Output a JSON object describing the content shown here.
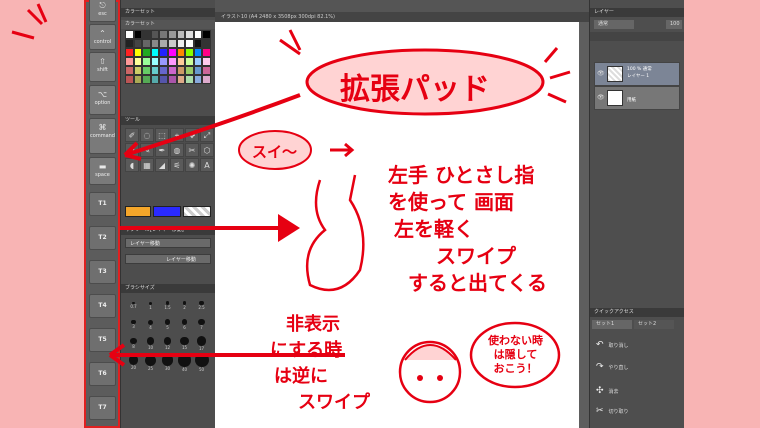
{
  "edge_pad": {
    "keys": [
      {
        "label": "esc",
        "icon": "escape-icon",
        "glyph": "⎋"
      },
      {
        "label": "control",
        "icon": "control-icon",
        "glyph": "⌃"
      },
      {
        "label": "shift",
        "icon": "shift-icon",
        "glyph": "⇧"
      },
      {
        "label": "option",
        "icon": "option-icon",
        "glyph": "⌥"
      },
      {
        "label": "command",
        "icon": "command-icon",
        "glyph": "⌘"
      },
      {
        "label": "space",
        "icon": "space-icon",
        "glyph": "▬"
      }
    ],
    "tool_keys": [
      "T1",
      "T2",
      "T3",
      "T4",
      "T5",
      "T6",
      "T7"
    ]
  },
  "color_set_panel": {
    "title": "カラーセット",
    "set_title": "カラーセット",
    "swatches": [
      "#ffffff",
      "#000000",
      "#333333",
      "#555555",
      "#777777",
      "#999999",
      "#bbbbbb",
      "#dddddd",
      "#ffffff",
      "#000000",
      "#222222",
      "#444444",
      "#666666",
      "#888888",
      "#aaaaaa",
      "#cccccc",
      "#eeeeee",
      "#ffffff",
      "#111111",
      "#333333",
      "#ff2222",
      "#ffff00",
      "#22aa22",
      "#00ffff",
      "#2222ff",
      "#ff00ff",
      "#ff8800",
      "#88ff00",
      "#0088ff",
      "#ff0088",
      "#ff9999",
      "#ffff99",
      "#99ff99",
      "#99ffff",
      "#9999ff",
      "#ff99ff",
      "#ffcc99",
      "#ccff99",
      "#99ccff",
      "#ffccee",
      "#cc6666",
      "#cccc66",
      "#66cc66",
      "#66cccc",
      "#6666cc",
      "#cc66cc",
      "#cc9966",
      "#99cc66",
      "#6699cc",
      "#cc6699",
      "#bb5555",
      "#aaaa55",
      "#55aa55",
      "#55aaaa",
      "#5555aa",
      "#aa55aa",
      "#ddaa88",
      "#aaddaa",
      "#88aadd",
      "#ddaacc"
    ]
  },
  "tool_panel": {
    "title": "ツール",
    "tools": [
      "✐",
      "◌",
      "⬚",
      "⌖",
      "✥",
      "⤢",
      "⚲",
      "✎",
      "✒",
      "◍",
      "✂",
      "⬡",
      "◖",
      "▦",
      "◢",
      "⚟",
      "✺",
      "A"
    ]
  },
  "subtool_panel": {
    "title": "サブツール[レイヤー移動]",
    "items": [
      "レイヤー移動",
      "レイヤー移動"
    ]
  },
  "brush_size_panel": {
    "title": "ブラシサイズ",
    "sizes": [
      "0.7",
      "1",
      "1.5",
      "2",
      "2.5",
      "3",
      "4",
      "5",
      "6",
      "7",
      "8",
      "10",
      "12",
      "15",
      "17",
      "20",
      "25",
      "30",
      "40",
      "50"
    ]
  },
  "canvas": {
    "tab_title": "イラスト10 (A4 2480 x 3508px 300dpi 82.1%)"
  },
  "layer_panel": {
    "title": "レイヤー",
    "blend_mode": "通常",
    "opacity": "100",
    "layers": [
      {
        "line1": "100 % 通常",
        "line2": "レイヤー 1"
      },
      {
        "line1": "",
        "line2": "用紙"
      }
    ]
  },
  "quick_access": {
    "title": "クイックアクセス",
    "tabs": [
      "セット1",
      "セット2"
    ],
    "items": [
      {
        "label": "取り消し",
        "icon": "undo-icon",
        "glyph": "↶"
      },
      {
        "label": "やり直し",
        "icon": "redo-icon",
        "glyph": "↷"
      },
      {
        "label": "消去",
        "icon": "clear-icon",
        "glyph": "✣"
      },
      {
        "label": "切り取り",
        "icon": "scissors-icon",
        "glyph": "✂"
      }
    ]
  },
  "annotations": {
    "title": "拡張パッド",
    "swipe": "スイ〜",
    "instruction": [
      "左手 ひとさし指",
      "を使って 画面",
      "左を軽く",
      "スワイプ",
      "すると出てくる"
    ],
    "hide": [
      "非表示",
      "にする時",
      "は逆に",
      "スワイプ"
    ],
    "bubble": [
      "使わない時",
      "は隠して",
      "おこう！"
    ]
  },
  "colors": {
    "accent": "#e60012",
    "background": "#f8b4b4"
  }
}
